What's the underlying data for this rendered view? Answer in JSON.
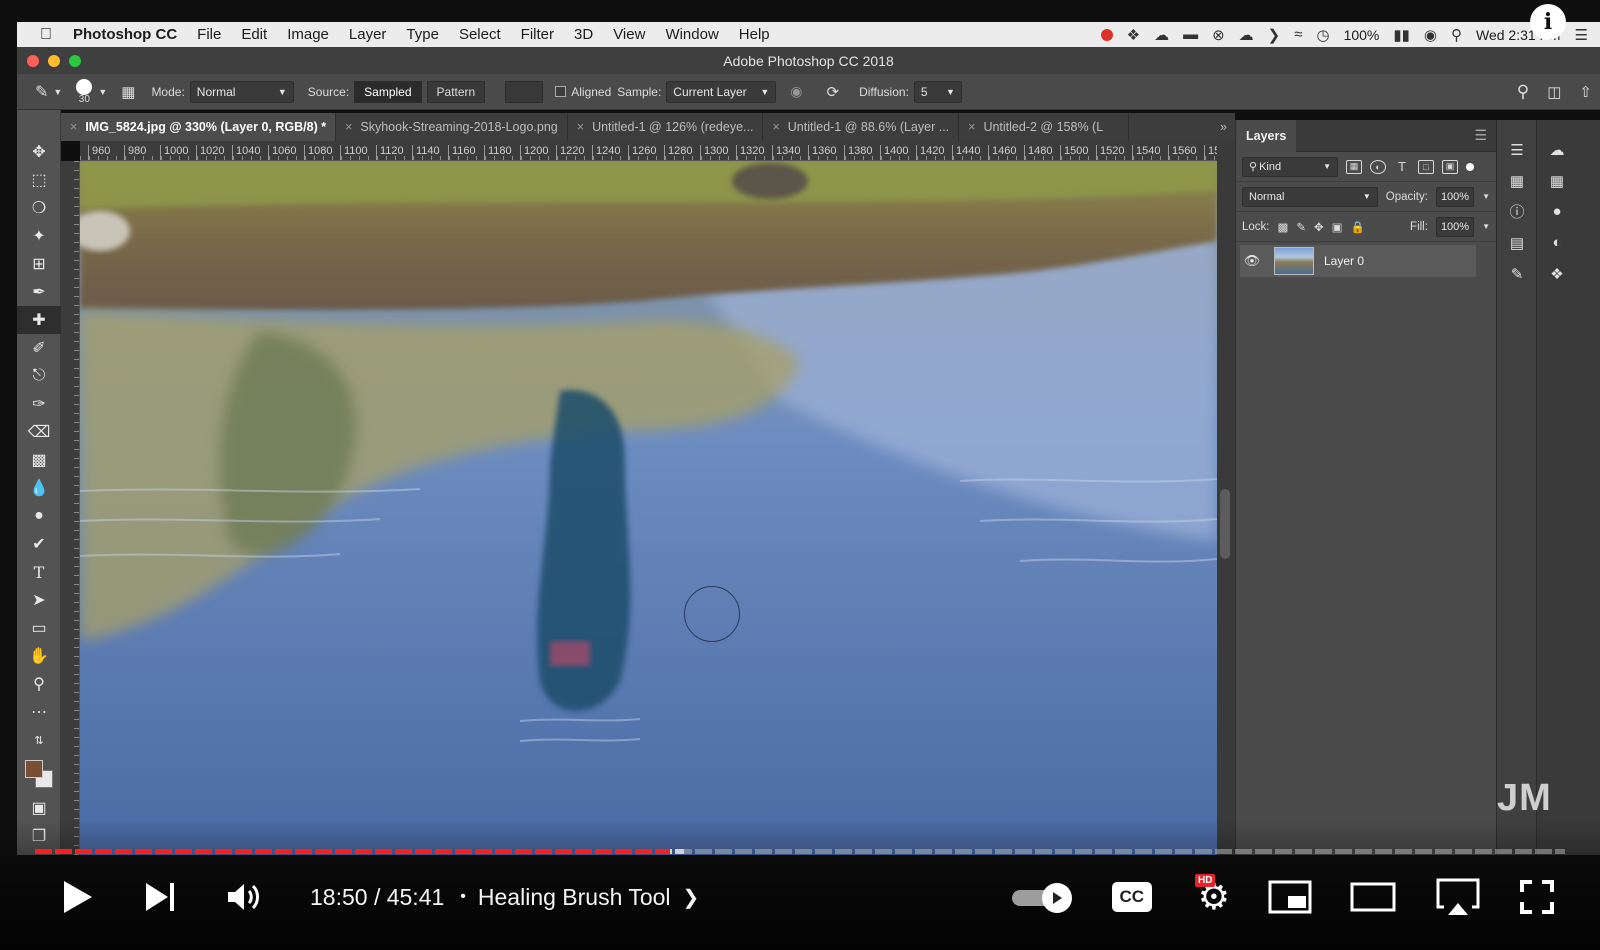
{
  "menubar": {
    "apple": "",
    "app_name": "Photoshop CC",
    "menus": [
      "File",
      "Edit",
      "Image",
      "Layer",
      "Type",
      "Select",
      "Filter",
      "3D",
      "View",
      "Window",
      "Help"
    ],
    "battery": "100%",
    "clock": "Wed 2:31 PM"
  },
  "window": {
    "title": "Adobe Photoshop CC 2018",
    "info_badge": "i"
  },
  "options": {
    "brush_size": "30",
    "mode_label": "Mode:",
    "mode_value": "Normal",
    "source_label": "Source:",
    "source_sampled": "Sampled",
    "source_pattern": "Pattern",
    "aligned_label": "Aligned",
    "sample_label": "Sample:",
    "sample_value": "Current Layer",
    "diffusion_label": "Diffusion:",
    "diffusion_value": "5"
  },
  "tabs": [
    {
      "label": "IMG_5824.jpg @ 330% (Layer 0, RGB/8) *",
      "active": true
    },
    {
      "label": "Skyhook-Streaming-2018-Logo.png",
      "active": false
    },
    {
      "label": "Untitled-1 @ 126% (redeye...",
      "active": false
    },
    {
      "label": "Untitled-1 @ 88.6% (Layer ...",
      "active": false
    },
    {
      "label": "Untitled-2 @ 158% (L",
      "active": false
    }
  ],
  "ruler_labels": [
    "960",
    "980",
    "1000",
    "1020",
    "1040",
    "1060",
    "1080",
    "1100",
    "1120",
    "1140",
    "1160",
    "1180",
    "1200",
    "1220",
    "1240",
    "1260",
    "1280",
    "1300",
    "1320",
    "1340",
    "1360",
    "1380",
    "1400",
    "1420",
    "1440",
    "1460",
    "1480",
    "1500",
    "1520",
    "1540",
    "1560",
    "15"
  ],
  "layers_panel": {
    "tab": "Layers",
    "filter_kind": "Kind",
    "blend_mode": "Normal",
    "opacity_label": "Opacity:",
    "opacity_value": "100%",
    "lock_label": "Lock:",
    "fill_label": "Fill:",
    "fill_value": "100%",
    "layers": [
      {
        "name": "Layer 0",
        "visible": true
      }
    ]
  },
  "watermark": "JM",
  "player": {
    "time": "18:50 / 45:41",
    "separator": "•",
    "chapter": "Healing Brush Tool",
    "played_fraction": 0.415,
    "cc": "CC",
    "hd": "HD"
  }
}
